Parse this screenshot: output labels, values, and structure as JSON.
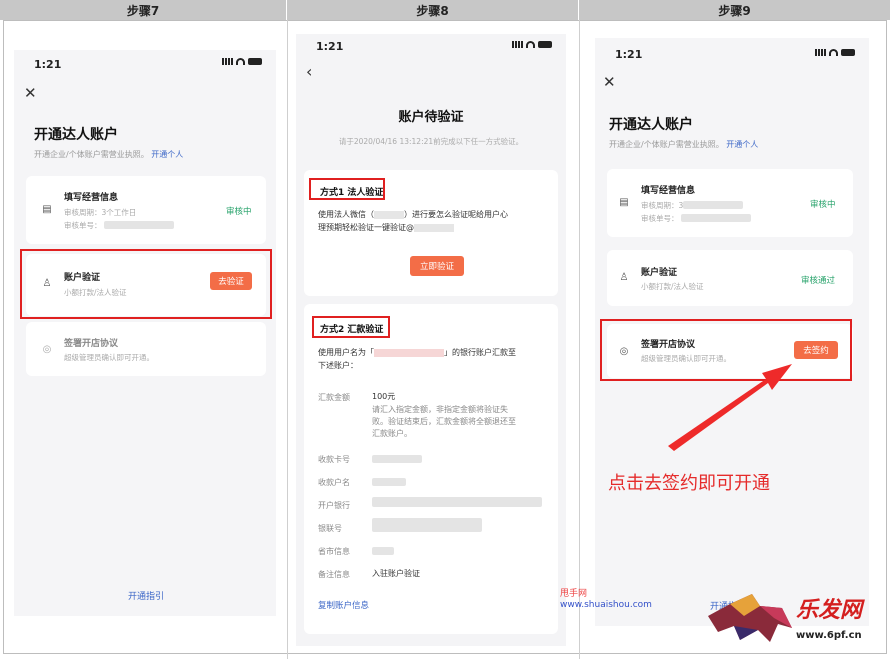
{
  "headers": [
    "步骤7",
    "步骤8",
    "步骤9"
  ],
  "status_time": "1:21",
  "step7": {
    "title": "开通达人账户",
    "sub_text": "开通企业/个体账户需营业执照。",
    "sub_link": "开通个人",
    "card1": {
      "title": "填写经营信息",
      "line1": "审核周期：3个工作日",
      "line2": "审核单号：",
      "status": "审核中"
    },
    "card2": {
      "title": "账户验证",
      "line1": "小额打款/法人验证",
      "button": "去验证"
    },
    "card3": {
      "title": "签署开店协议",
      "line1": "超级管理员确认即可开通。"
    },
    "guide": "开通指引"
  },
  "step8": {
    "title": "账户待验证",
    "sub": "请于2020/04/16 13:12:21前完成以下任一方式验证。",
    "m1": {
      "head": "方式1  法人验证",
      "text1_a": "使用法人微信（",
      "text1_b": "）进行要怎么验证呢给用户心",
      "text2": "理预期轻松验证一键验证@",
      "button": "立即验证"
    },
    "m2": {
      "head": "方式2  汇款验证",
      "text1_a": "使用用户名为「",
      "text1_b": "」的银行账户汇款至",
      "text2": "下述账户：",
      "amount_k": "汇款金额",
      "amount_v": "100元",
      "note1": "请汇入指定金额，非指定金额将验证失",
      "note2": "败。验证结束后，汇款金额将全额退还至",
      "note3": "汇款账户。",
      "rows": [
        "收款卡号",
        "收款户名",
        "开户银行",
        "银联号",
        "省市信息",
        "备注信息"
      ],
      "remark_v": "入驻账户验证",
      "copy": "复制账户信息"
    }
  },
  "step9": {
    "title": "开通达人账户",
    "sub_text": "开通企业/个体账户需营业执照。",
    "sub_link": "开通个人",
    "card1": {
      "title": "填写经营信息",
      "line1": "审核周期：3个工作日",
      "line2": "审核单号：",
      "status": "审核中"
    },
    "card2": {
      "title": "账户验证",
      "line1": "小额打款/法人验证",
      "status": "审核通过"
    },
    "card3": {
      "title": "签署开店协议",
      "line1": "超级管理员确认即可开通。",
      "button": "去签约"
    },
    "guide": "开通指引"
  },
  "annotation": "点击去签约即可开通",
  "watermark": {
    "name": "甩手网",
    "url": "www.shuaishou.com"
  },
  "logo": {
    "cn": "乐发网",
    "url": "www.6pf.cn"
  },
  "colors": {
    "accent": "#f36d47",
    "link": "#3b66c7",
    "ok": "#26a26a",
    "highlight": "#e02020"
  }
}
